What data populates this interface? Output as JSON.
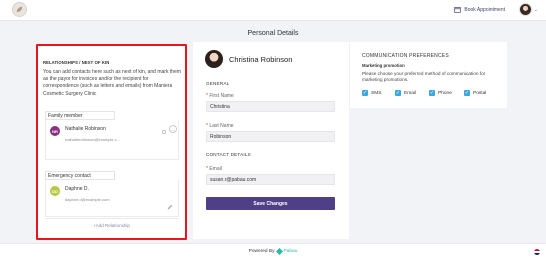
{
  "header": {
    "book_label": "Book Appointment"
  },
  "page": {
    "title": "Personal Details"
  },
  "relationships": {
    "heading": "RELATIONSHIPS / NEXT OF KIN",
    "description": "You can add contacts here such as next of kin, and mark them as the payor for invoices and/or the recipient for correspondence (such as letters and emails) from Maniera Cosmetic Surgery Clinic",
    "family_label": "Family member",
    "family": {
      "initials": "NR",
      "name": "Nathalie Robinson",
      "email": "nathalierobinson@example.c..."
    },
    "emergency_label": "Emergency contact",
    "emergency": {
      "initials": "DD",
      "name": "Daphne D.",
      "email": "daphne.d@example.com"
    },
    "add_label": "+Add Relationship"
  },
  "profile": {
    "name": "Christina Robinson",
    "general_label": "GENERAL",
    "first_name_label": "First Name",
    "first_name": "Christina",
    "last_name_label": "Last Name",
    "last_name": "Robinson",
    "contact_label": "CONTACT DETAILS",
    "email_label": "Email",
    "email": "susan.r@pabau.com",
    "save_label": "Save Changes"
  },
  "communication": {
    "heading": "COMMUNICATION PREFERENCES",
    "subheading": "Marketing promotion",
    "description": "Please choose your preferred method of communication for marketing promotions.",
    "options": {
      "sms": "SMS",
      "email": "Email",
      "phone": "Phone",
      "postal": "Postal"
    }
  },
  "footer": {
    "powered_label": "Powered By",
    "brand": "Pabau"
  },
  "colors": {
    "primary": "#4e3f86",
    "highlight_border": "#e8141e",
    "checkbox": "#3ea7db",
    "brand": "#2db9a6"
  }
}
